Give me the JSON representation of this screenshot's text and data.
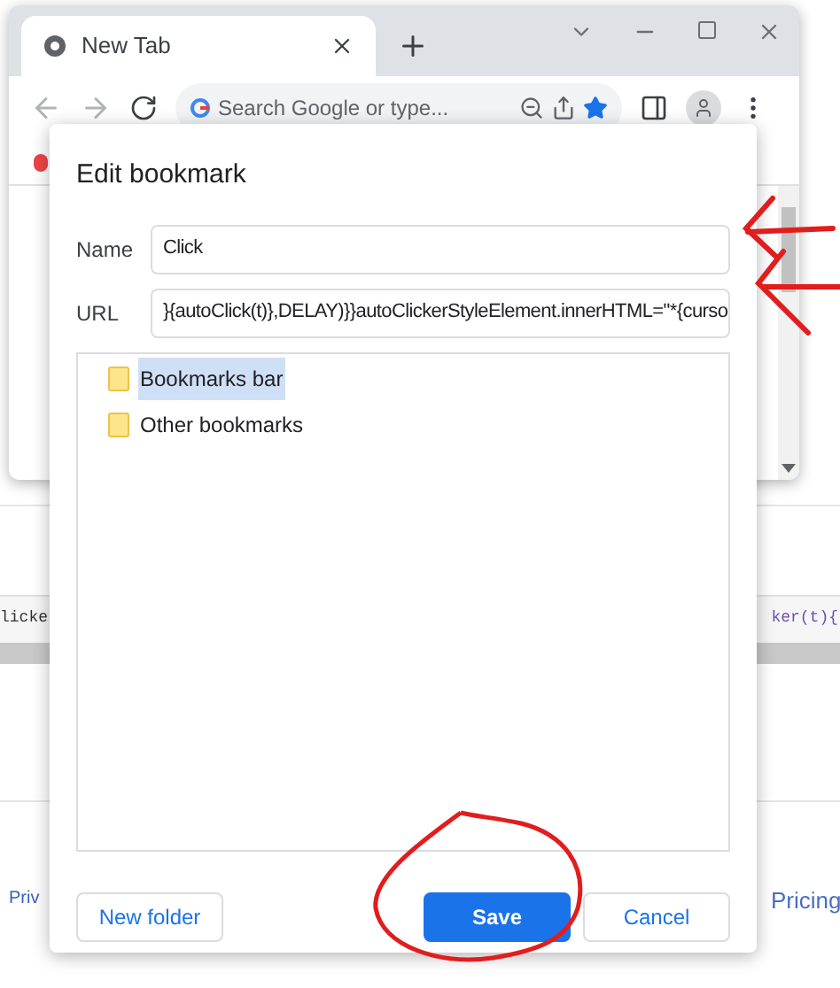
{
  "background_page": {
    "code_left": "licke",
    "code_right": "ker(t){",
    "footer_left": "Priv",
    "footer_right": "Pricing"
  },
  "browser": {
    "tab": {
      "title": "New Tab",
      "selected": true
    },
    "omnibox": {
      "placeholder": "Search Google or type..."
    }
  },
  "dialog": {
    "title": "Edit bookmark",
    "fields": [
      {
        "label": "Name",
        "value": "Click"
      },
      {
        "label": "URL",
        "value": "}{autoClick(t)},DELAY)}}autoClickerStyleElement.innerHTML=\"*{curso"
      }
    ],
    "folders": [
      {
        "label": "Bookmarks bar",
        "selected": true
      },
      {
        "label": "Other bookmarks",
        "selected": false
      }
    ],
    "buttons": [
      {
        "label": "New folder",
        "kind": "secondary"
      },
      {
        "label": "Save",
        "kind": "primary"
      },
      {
        "label": "Cancel",
        "kind": "secondary"
      }
    ]
  }
}
